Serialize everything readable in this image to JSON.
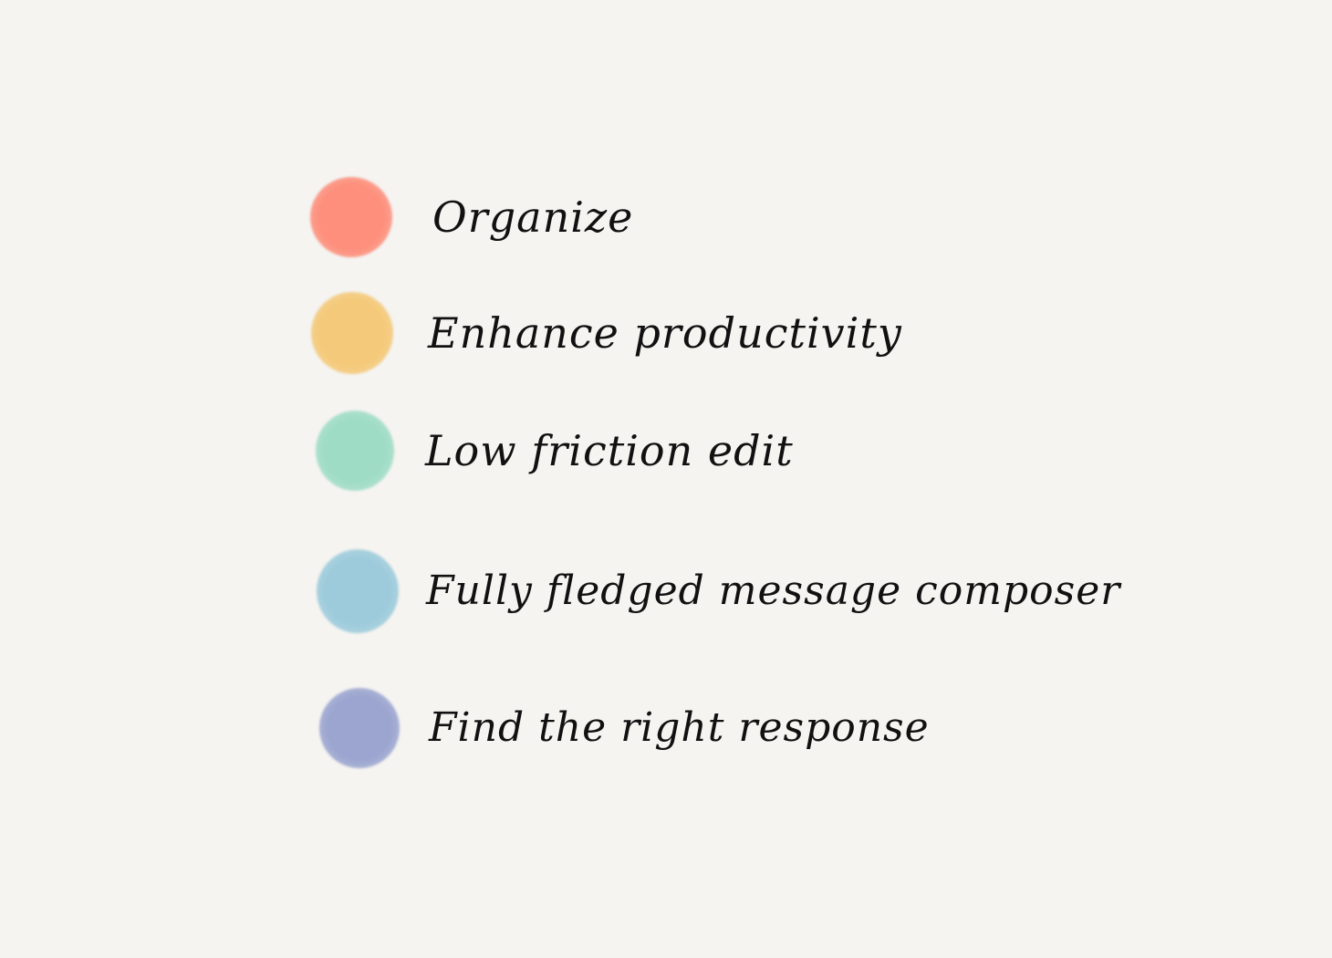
{
  "items": [
    {
      "label": "Organize",
      "color": "#fd8f7c"
    },
    {
      "label": "Enhance productivity",
      "color": "#f4c979"
    },
    {
      "label": "Low friction edit",
      "color": "#9fdcc6"
    },
    {
      "label": "Fully fledged message composer",
      "color": "#9dcbdb"
    },
    {
      "label": "Find the right response",
      "color": "#9ba5cf"
    }
  ],
  "background": "#f5f4f1"
}
